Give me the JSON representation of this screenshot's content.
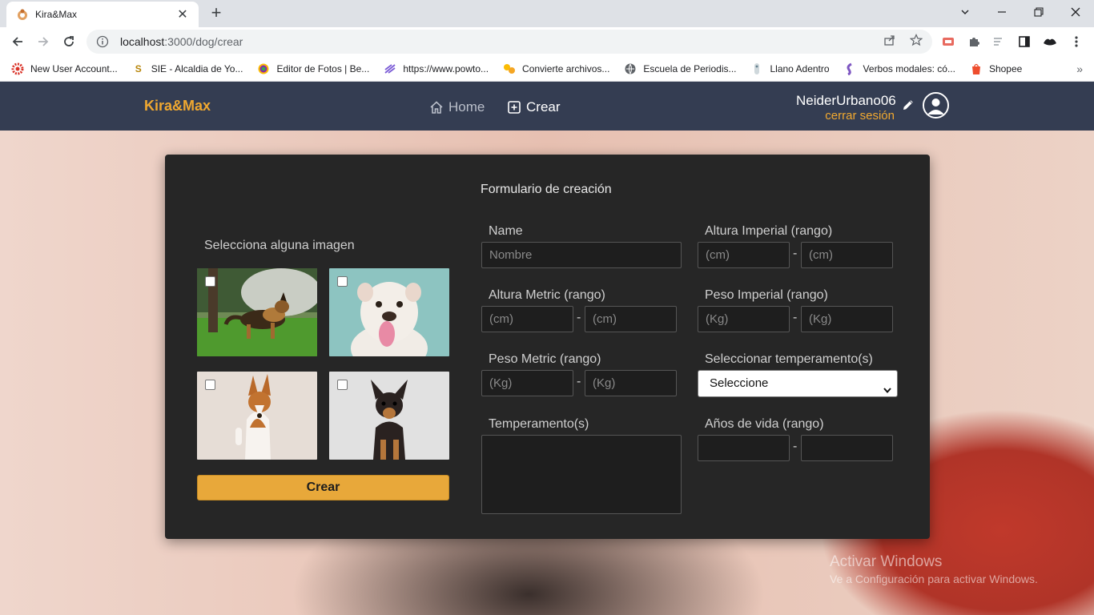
{
  "browser": {
    "tab_title": "Kira&Max",
    "url_host": "localhost",
    "url_path": ":3000/dog/crear",
    "bookmarks": [
      {
        "label": "New User Account...",
        "icon": "gear-red-icon"
      },
      {
        "label": "SIE - Alcaldia de Yo...",
        "icon": "s-icon"
      },
      {
        "label": "Editor de Fotos | Be...",
        "icon": "photo-editor-icon"
      },
      {
        "label": "https://www.powto...",
        "icon": "powtoon-icon"
      },
      {
        "label": "Convierte archivos...",
        "icon": "convert-icon"
      },
      {
        "label": "Escuela de Periodis...",
        "icon": "globe-icon"
      },
      {
        "label": "Llano Adentro",
        "icon": "llano-icon"
      },
      {
        "label": "Verbos modales: có...",
        "icon": "verbos-icon"
      },
      {
        "label": "Shopee",
        "icon": "shopee-icon"
      }
    ]
  },
  "appbar": {
    "brand": "Kira&Max",
    "nav_home": "Home",
    "nav_create": "Crear",
    "user_name": "NeiderUrbano06",
    "logout": "cerrar sesión"
  },
  "form": {
    "title": "Formulario de creación",
    "gallery_title": "Selecciona alguna imagen",
    "create_button": "Crear",
    "name_label": "Name",
    "name_placeholder": "Nombre",
    "altura_imperial_label": "Altura Imperial (rango)",
    "altura_metric_label": "Altura Metric (rango)",
    "peso_imperial_label": "Peso Imperial (rango)",
    "peso_metric_label": "Peso Metric (rango)",
    "temperament_select_label": "Seleccionar temperamento(s)",
    "temperament_select_value": "Seleccione",
    "temperaments_label": "Temperamento(s)",
    "life_label": "Años de vida (rango)",
    "cm_placeholder": "(cm)",
    "kg_placeholder": "(Kg)",
    "dash": "-"
  },
  "watermark": {
    "line1": "Activar Windows",
    "line2": "Ve a Configuración para activar Windows."
  },
  "colors": {
    "appbar": "#343d52",
    "accent": "#f0a830",
    "card": "#262626",
    "button": "#e8a83a"
  }
}
